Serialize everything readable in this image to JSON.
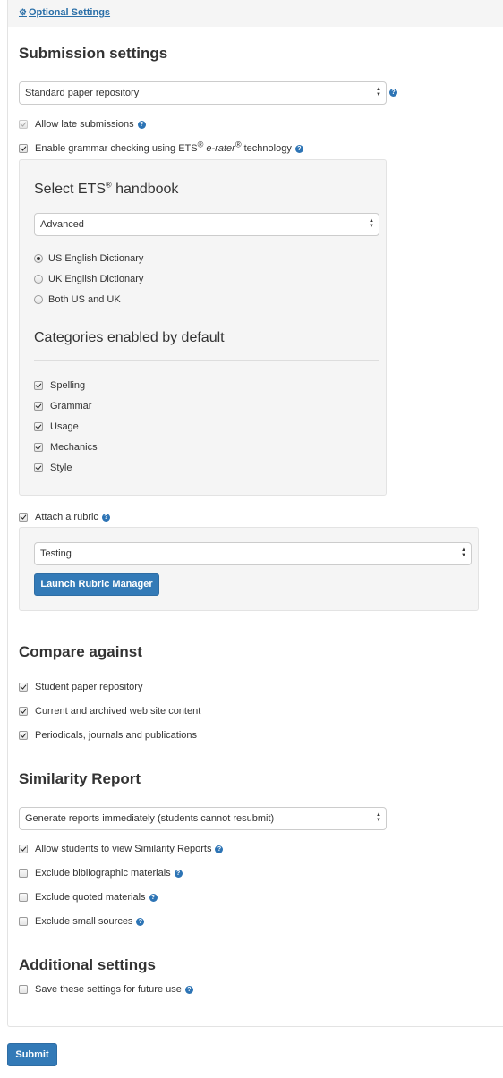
{
  "optional_settings_link": "Optional Settings",
  "submission": {
    "title": "Submission settings",
    "repository_select": "Standard paper repository",
    "allow_late": "Allow late submissions",
    "grammar": {
      "prefix": "Enable grammar checking using ETS",
      "reg": "®",
      "erater": "e-rater",
      "suffix": "technology"
    }
  },
  "ets": {
    "title_prefix": "Select ETS",
    "title_reg": "®",
    "title_suffix": " handbook",
    "handbook_select": "Advanced",
    "dictionaries": [
      {
        "label": "US English Dictionary",
        "selected": true
      },
      {
        "label": "UK English Dictionary",
        "selected": false
      },
      {
        "label": "Both US and UK",
        "selected": false
      }
    ],
    "categories_title": "Categories enabled by default",
    "categories": [
      {
        "label": "Spelling",
        "checked": true
      },
      {
        "label": "Grammar",
        "checked": true
      },
      {
        "label": "Usage",
        "checked": true
      },
      {
        "label": "Mechanics",
        "checked": true
      },
      {
        "label": "Style",
        "checked": true
      }
    ]
  },
  "rubric": {
    "label": "Attach a rubric",
    "select": "Testing",
    "launch_button": "Launch Rubric Manager"
  },
  "compare": {
    "title": "Compare against",
    "items": [
      {
        "label": "Student paper repository",
        "checked": true
      },
      {
        "label": "Current and archived web site content",
        "checked": true
      },
      {
        "label": "Periodicals, journals and publications",
        "checked": true
      }
    ]
  },
  "similarity": {
    "title": "Similarity Report",
    "select": "Generate reports immediately (students cannot resubmit)",
    "items": [
      {
        "label": "Allow students to view Similarity Reports",
        "checked": true
      },
      {
        "label": "Exclude bibliographic materials",
        "checked": false
      },
      {
        "label": "Exclude quoted materials",
        "checked": false
      },
      {
        "label": "Exclude small sources",
        "checked": false
      }
    ]
  },
  "additional": {
    "title": "Additional settings",
    "save_label": "Save these settings for future use"
  },
  "help_glyph": "?",
  "submit_button": "Submit",
  "colors": {
    "primary": "#337ab7",
    "link": "#2a6fa8",
    "well_bg": "#f5f5f5",
    "help_icon": "#2d74b5"
  }
}
